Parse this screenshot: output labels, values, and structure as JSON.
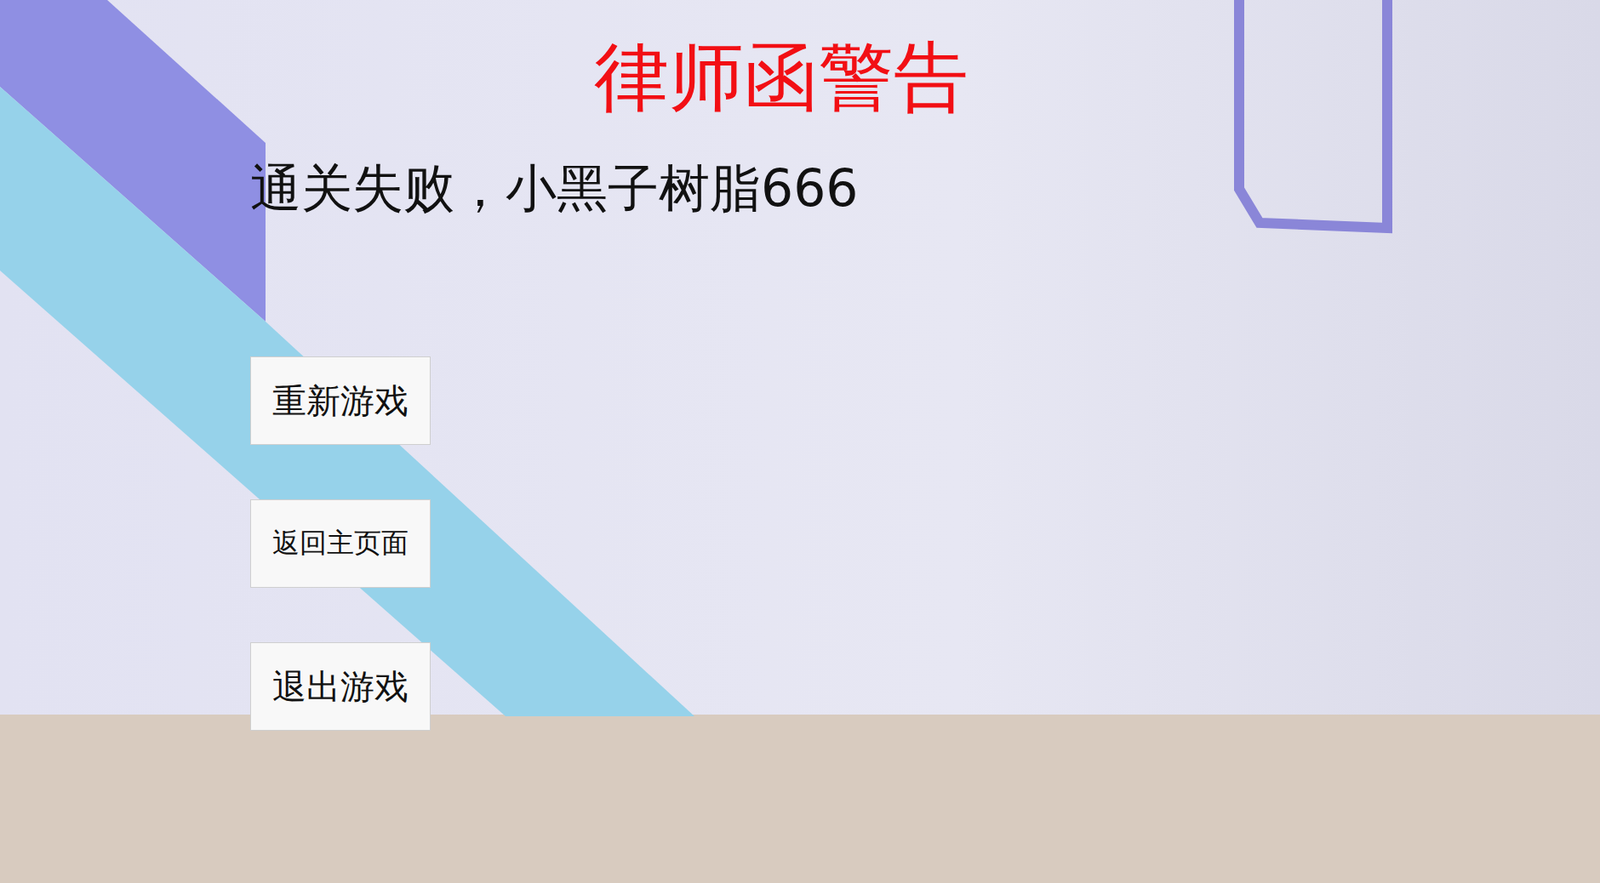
{
  "title": "律师函警告",
  "message": "通关失败，小黑子树脂666",
  "buttons": [
    "重新游戏",
    "返回主页面",
    "退出游戏"
  ]
}
